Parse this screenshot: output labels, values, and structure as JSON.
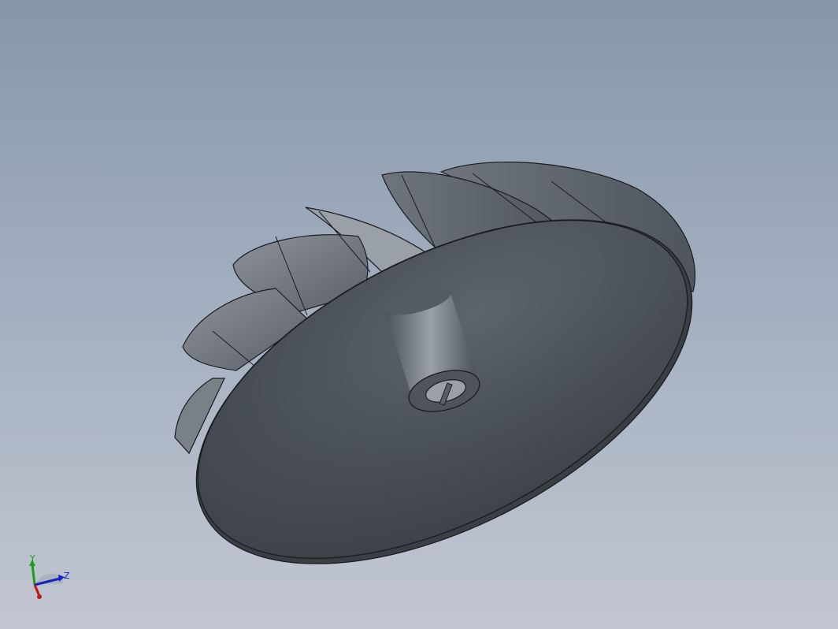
{
  "viewport": {
    "background_top": "#8697ab",
    "background_bottom": "#c2c6d2"
  },
  "model": {
    "name": "impeller",
    "body_color": "#4a5059",
    "blade_color": "#6a7079",
    "edge_color": "#1a1c20"
  },
  "triad": {
    "x_label": "",
    "y_label": "Y",
    "z_label": "Z",
    "x_color": "#c01818",
    "y_color": "#18a018",
    "z_color": "#1820c0"
  }
}
